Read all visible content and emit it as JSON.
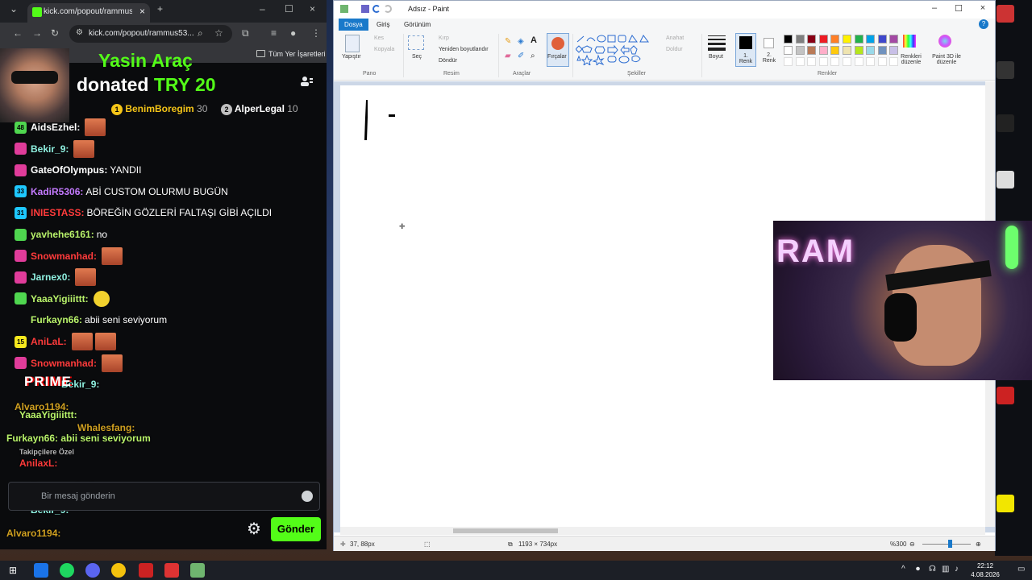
{
  "browser": {
    "tab_title": "kick.com/popout/rammus53/c",
    "url": "kick.com/popout/rammus53...",
    "bookmarks_label": "Tüm Yer İşaretleri"
  },
  "alert": {
    "name": "Yasin Araç",
    "prefix": "donated",
    "amount": "TRY 20"
  },
  "leaderboard": [
    {
      "rank": "1",
      "name": "BenimBoregim",
      "count": "30",
      "color": "#f5c518"
    },
    {
      "rank": "2",
      "name": "AlperLegal",
      "count": "10",
      "color": "#c0c0c0"
    }
  ],
  "chat": [
    {
      "badge": "48",
      "badge_color": "#4fd64f",
      "user": "AidsEzhel:",
      "user_color": "#ffffff",
      "text": "",
      "emote": "sticker"
    },
    {
      "badge": "",
      "badge_color": "#e03c9a",
      "user": "Bekir_9:",
      "user_color": "#8ff0e0",
      "text": "",
      "emote": "face"
    },
    {
      "badge": "",
      "badge_color": "#e03c9a",
      "user": "GateOfOlympus:",
      "user_color": "#ffffff",
      "text": "YANDII",
      "emote": ""
    },
    {
      "badge": "33",
      "badge_color": "#1ec8ff",
      "user": "KadiR5306:",
      "user_color": "#c47aff",
      "text": "ABİ CUSTOM OLURMU BUGÜN",
      "emote": ""
    },
    {
      "badge": "31",
      "badge_color": "#1ec8ff",
      "user": "INIESTASS:",
      "user_color": "#ff3b3b",
      "text": "BÖREĞİN GÖZLERİ FALTAŞI GİBİ AÇILDI",
      "emote": ""
    },
    {
      "badge": "",
      "badge_color": "#4fd64f",
      "user": "yavhehe6161:",
      "user_color": "#b8f26a",
      "text": "no",
      "emote": ""
    },
    {
      "badge": "",
      "badge_color": "#e03c9a",
      "user": "Snowmanhad:",
      "user_color": "#ff3b3b",
      "text": "",
      "emote": "face"
    },
    {
      "badge": "",
      "badge_color": "#e03c9a",
      "user": "Jarnex0:",
      "user_color": "#8ff0e0",
      "text": "",
      "emote": "face"
    },
    {
      "badge": "",
      "badge_color": "#4fd64f",
      "user": "YaaaYigiiittt:",
      "user_color": "#b8f26a",
      "text": "",
      "emote": "yellow"
    },
    {
      "badge": "",
      "badge_color": "",
      "user": "Furkayn66:",
      "user_color": "#b8f26a",
      "text": "abii seni seviyorum",
      "emote": ""
    },
    {
      "badge": "15",
      "badge_color": "#f5e81e",
      "user": "AniLaL:",
      "user_color": "#ff3b3b",
      "text": "",
      "emote": "face2"
    },
    {
      "badge": "",
      "badge_color": "#e03c9a",
      "user": "Snowmanhad:",
      "user_color": "#ff3b3b",
      "text": "",
      "emote": "face"
    }
  ],
  "overlay": {
    "prime": "PRIME",
    "lines": [
      {
        "text": "Bekir_9:",
        "color": "#8ff0e0"
      },
      {
        "text": "Alvaro1194:",
        "color": "#d0a020"
      },
      {
        "text": "YaaaYigiiittt:",
        "color": "#b8f26a"
      },
      {
        "text": "Whalesfang:",
        "color": "#d0a020"
      },
      {
        "text": "Furkayn66: abii seni seviyorum",
        "color": "#b8f26a"
      },
      {
        "text": "Takipçilere Özel",
        "color": "#bbbbbb"
      },
      {
        "text": "AnilaxL:",
        "color": "#ff3b3b"
      },
      {
        "text": "Snowmanhad:",
        "color": "#ff3b3b"
      },
      {
        "text": "Bekir_9:",
        "color": "#8ff0e0"
      },
      {
        "text": "Alvaro1194:",
        "color": "#d0a020"
      },
      {
        "text": "Whalesfang:",
        "color": "#b8f26a"
      }
    ]
  },
  "input": {
    "placeholder": "Bir mesaj gönderin"
  },
  "send_label": "Gönder",
  "paint": {
    "title": "Adsız - Paint",
    "tabs": [
      "Dosya",
      "Giriş",
      "Görünüm"
    ],
    "groups": [
      "Pano",
      "Resim",
      "Araçlar",
      "Şekiller",
      "Renkler"
    ],
    "clipboard": {
      "paste": "Yapıştır",
      "cut": "Kes",
      "copy": "Kopyala"
    },
    "image": {
      "select": "Seç",
      "crop": "Kırp",
      "resize": "Yeniden boyutlandır",
      "rotate": "Döndür"
    },
    "brushes": "Fırçalar",
    "shapes": {
      "outline": "Anahat",
      "fill": "Doldur"
    },
    "size": "Boyut",
    "color1": "1. Renk",
    "color2": "2. Renk",
    "edit_colors": "Renkleri düzenle",
    "paint3d": "Paint 3D ile düzenle",
    "palette": [
      "#000000",
      "#7f7f7f",
      "#880015",
      "#ed1c24",
      "#ff7f27",
      "#fff200",
      "#22b14c",
      "#00a2e8",
      "#3f48cc",
      "#a349a4",
      "#ffffff",
      "#c3c3c3",
      "#b97a57",
      "#ffaec9",
      "#ffc90e",
      "#efe4b0",
      "#b5e61d",
      "#99d9ea",
      "#7092be",
      "#c8bfe7"
    ],
    "status": {
      "cursor": "37, 88px",
      "size": "1193 × 734px",
      "zoom": "%300"
    }
  },
  "taskbar": {
    "time": "22:12",
    "date": "4.08.2026"
  }
}
